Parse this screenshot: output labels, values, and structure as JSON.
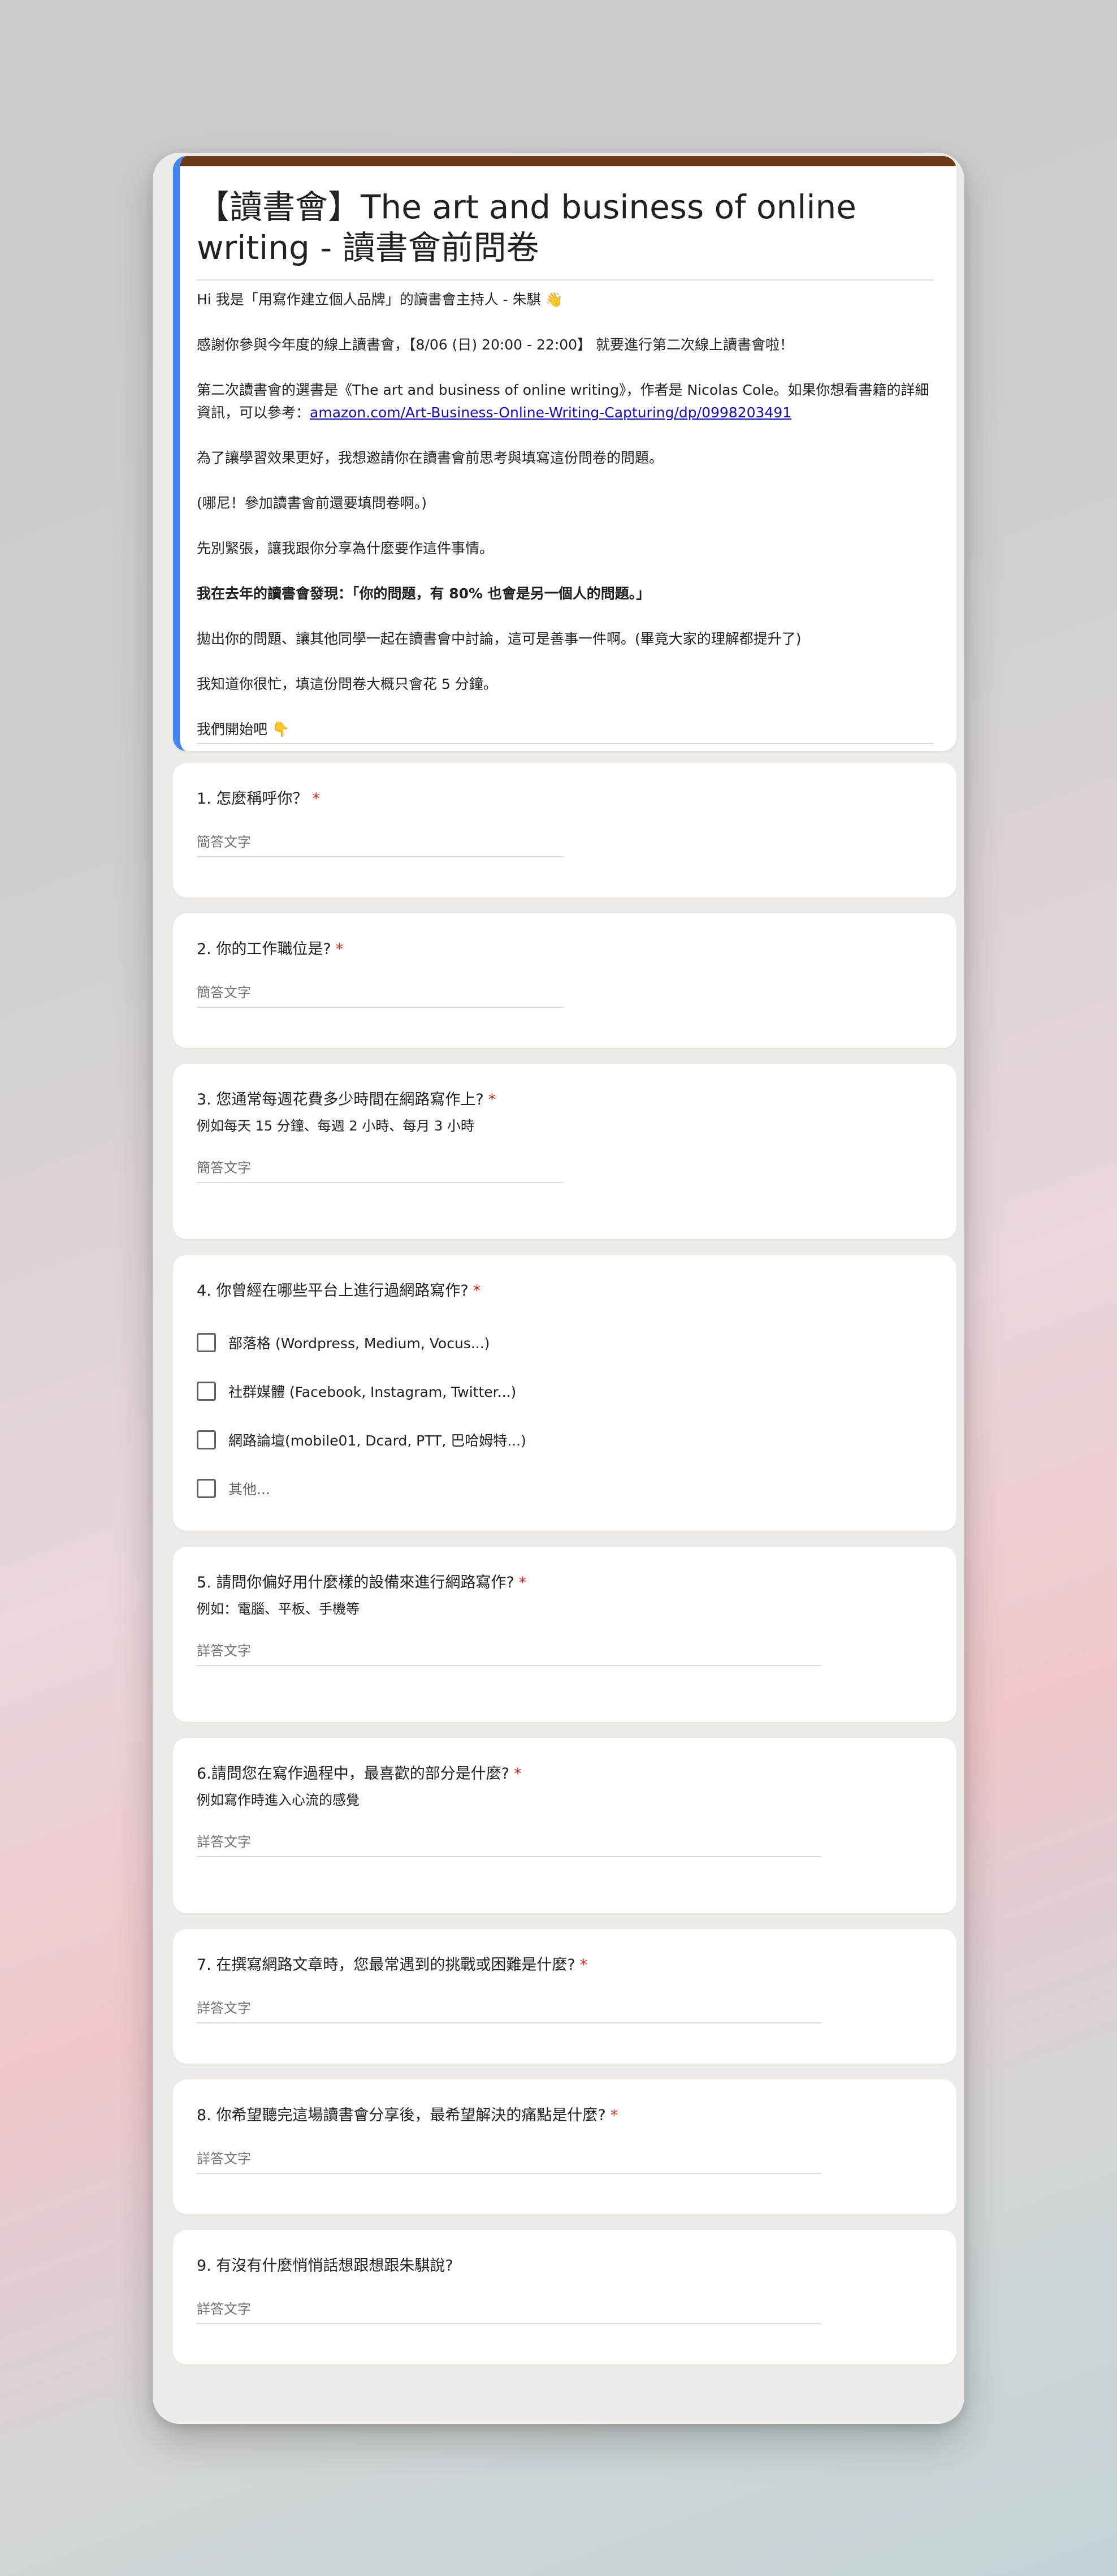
{
  "form": {
    "title": "【讀書會】The art and business of online writing - 讀書會前問卷",
    "description": {
      "p1": "Hi  我是「用寫作建立個人品牌」的讀書會主持人 - 朱騏 👋",
      "p2": "感謝你參與今年度的線上讀書會，【8/06 (日) 20:00 - 22:00】 就要進行第二次線上讀書會啦！",
      "p3_text": "第二次讀書會的選書是《The art and business of online writing》，作者是 Nicolas Cole。如果你想看書籍的詳細資訊，可以參考：",
      "p3_link": "amazon.com/Art-Business-Online-Writing-Capturing/dp/0998203491",
      "p4": "為了讓學習效果更好，我想邀請你在讀書會前思考與填寫這份問卷的問題。",
      "p5": "(哪尼！參加讀書會前還要填問卷啊。)",
      "p6": "先別緊張，讓我跟你分享為什麼要作這件事情。",
      "p7": "我在去年的讀書會發現：「你的問題，有 80% 也會是另一個人的問題。」",
      "p8": "拋出你的問題、讓其他同學一起在讀書會中討論，這可是善事一件啊。(畢竟大家的理解都提升了)",
      "p9": "我知道你很忙，填這份問卷大概只會花 5 分鐘。",
      "p10": "我們開始吧 👇"
    }
  },
  "questions": [
    {
      "title": "1. 怎麼稱呼你？",
      "required_mark": "*",
      "placeholder": "簡答文字"
    },
    {
      "title": "2. 你的工作職位是?",
      "required_mark": "*",
      "placeholder": "簡答文字"
    },
    {
      "title": "3. 您通常每週花費多少時間在網路寫作上?",
      "required_mark": "*",
      "help": "例如每天 15 分鐘、每週 2 小時、每月 3 小時",
      "placeholder": "簡答文字"
    },
    {
      "title": "4. 你曾經在哪些平台上進行過網路寫作?",
      "required_mark": "*",
      "options": [
        "部落格 (Wordpress, Medium, Vocus...)",
        "社群媒體 (Facebook, Instagram, Twitter...)",
        "網路論壇(mobile01, Dcard, PTT, 巴哈姆特...)",
        "其他..."
      ]
    },
    {
      "title": "5. 請問你偏好用什麼樣的設備來進行網路寫作?",
      "required_mark": "*",
      "help": "例如：電腦、平板、手機等",
      "placeholder": "詳答文字"
    },
    {
      "title": "6.請問您在寫作過程中，最喜歡的部分是什麼?",
      "required_mark": "*",
      "help": "例如寫作時進入心流的感覺",
      "placeholder": "詳答文字"
    },
    {
      "title": "7. 在撰寫網路文章時，您最常遇到的挑戰或困難是什麼?",
      "required_mark": "*",
      "placeholder": "詳答文字"
    },
    {
      "title": "8. 你希望聽完這場讀書會分享後，最希望解決的痛點是什麼?",
      "required_mark": "*",
      "placeholder": "詳答文字"
    },
    {
      "title": "9. 有沒有什麼悄悄話想跟想跟朱騏說?",
      "placeholder": "詳答文字"
    }
  ],
  "colors": {
    "accent_left_border": "#4285f4",
    "header_top_bar": "#6a3a1a",
    "required": "#d93025",
    "link": "#1a0dab"
  }
}
